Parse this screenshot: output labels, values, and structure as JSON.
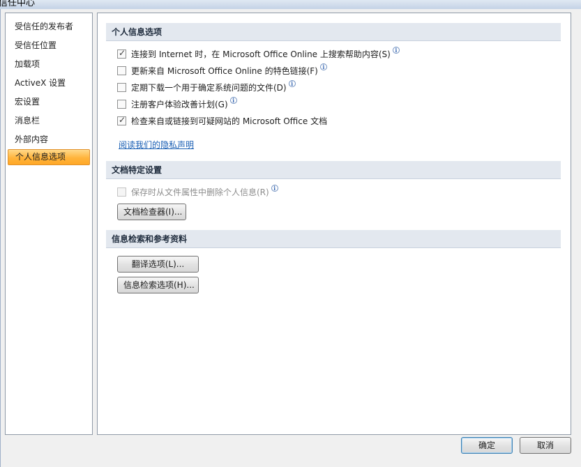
{
  "window": {
    "title": "信任中心"
  },
  "nav": {
    "items": [
      {
        "label": "受信任的发布者",
        "selected": false
      },
      {
        "label": "受信任位置",
        "selected": false
      },
      {
        "label": "加载项",
        "selected": false
      },
      {
        "label": "ActiveX 设置",
        "selected": false
      },
      {
        "label": "宏设置",
        "selected": false
      },
      {
        "label": "消息栏",
        "selected": false
      },
      {
        "label": "外部内容",
        "selected": false
      },
      {
        "label": "个人信息选项",
        "selected": true
      }
    ]
  },
  "privacy": {
    "header": "个人信息选项",
    "options": [
      {
        "label": "连接到 Internet 时，在 Microsoft Office Online 上搜索帮助内容(S)",
        "checked": true,
        "info_icon": "info-icon"
      },
      {
        "label": "更新来自 Microsoft Office Online 的特色链接(F)",
        "checked": false,
        "info_icon": "info-icon"
      },
      {
        "label": "定期下载一个用于确定系统问题的文件(D)",
        "checked": false,
        "info_icon": "info-icon"
      },
      {
        "label": "注册客户体验改善计划(G)",
        "checked": false,
        "info_icon": "info-icon"
      },
      {
        "label": "检查来自或链接到可疑网站的 Microsoft Office 文档",
        "checked": true
      }
    ],
    "privacy_link": "阅读我们的隐私声明"
  },
  "document": {
    "header": "文档特定设置",
    "remove_info_label": "保存时从文件属性中删除个人信息(R)",
    "remove_info_checked": false,
    "remove_info_disabled": true,
    "inspector_button": "文档检查器(I)..."
  },
  "research": {
    "header": "信息检索和参考资料",
    "translation_button": "翻译选项(L)...",
    "research_button": "信息检索选项(H)..."
  },
  "footer": {
    "ok_label": "确定",
    "cancel_label": "取消"
  }
}
